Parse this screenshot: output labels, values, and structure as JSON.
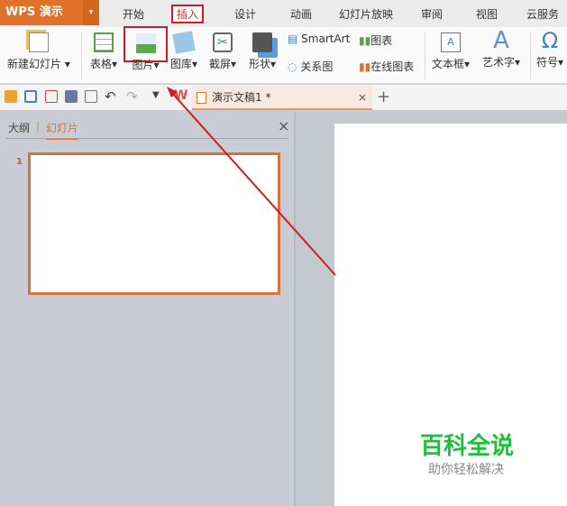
{
  "app": {
    "title": "WPS 演示"
  },
  "menu_tabs": [
    "开始",
    "插入",
    "设计",
    "动画",
    "幻灯片放映",
    "审阅",
    "视图",
    "云服务"
  ],
  "active_tab": "插入",
  "ribbon": {
    "new_slide": "新建幻灯片",
    "table": "表格",
    "picture": "图片",
    "gallery": "图库",
    "screenshot": "截屏",
    "shapes": "形状",
    "smartart": "SmartArt",
    "chart": "图表",
    "relation": "关系图",
    "online_chart": "在线图表",
    "textbox": "文本框",
    "wordart": "艺术字",
    "symbol": "符号"
  },
  "document_tab": {
    "name": "演示文稿1 *"
  },
  "panel": {
    "outline_tab": "大纲",
    "slides_tab": "幻灯片",
    "slide_number": "1"
  },
  "watermark": {
    "title": "百科全说",
    "subtitle": "助你轻松解决"
  },
  "colors": {
    "accent": "#e0702a",
    "highlight": "#d01c1c",
    "watermark": "#1fbf3a"
  }
}
